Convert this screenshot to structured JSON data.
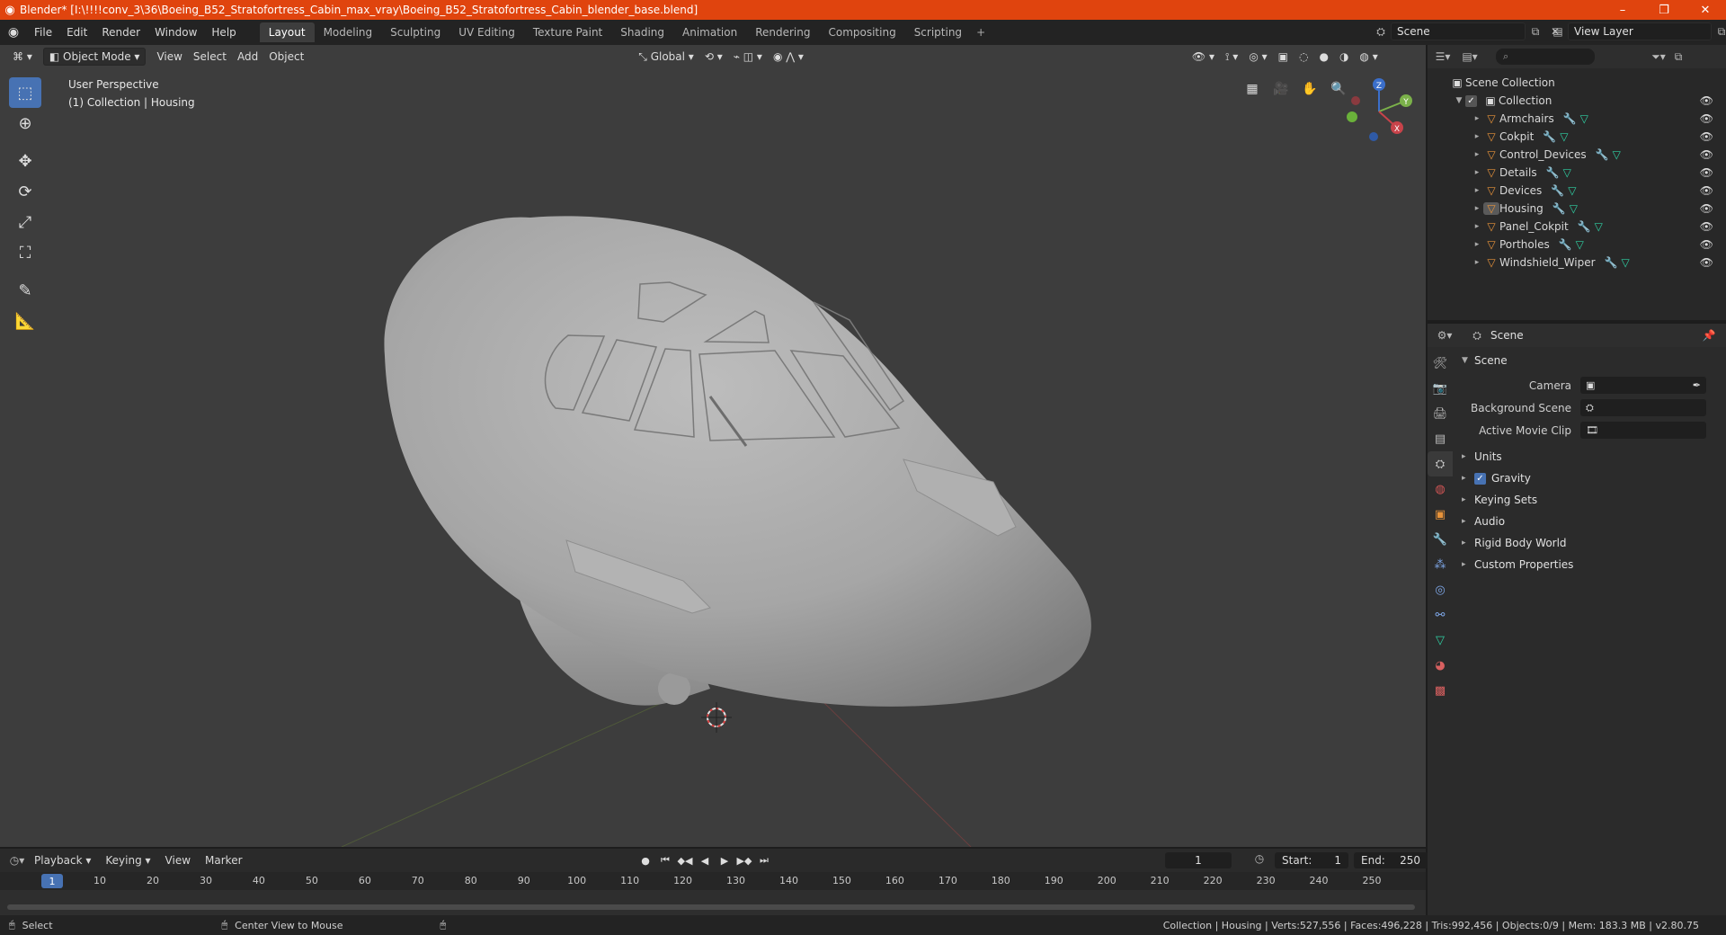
{
  "window": {
    "title": "Blender* [I:\\!!!!conv_3\\36\\Boeing_B52_Stratofortress_Cabin_max_vray\\Boeing_B52_Stratofortress_Cabin_blender_base.blend]"
  },
  "menus": [
    "File",
    "Edit",
    "Render",
    "Window",
    "Help"
  ],
  "workspaces": [
    "Layout",
    "Modeling",
    "Sculpting",
    "UV Editing",
    "Texture Paint",
    "Shading",
    "Animation",
    "Rendering",
    "Compositing",
    "Scripting"
  ],
  "active_workspace": "Layout",
  "scene_name": "Scene",
  "view_layer": "View Layer",
  "viewport": {
    "mode": "Object Mode",
    "menus": [
      "View",
      "Select",
      "Add",
      "Object"
    ],
    "orientation": "Global",
    "perspective": "User Perspective",
    "context": "(1) Collection | Housing",
    "gizmo": {
      "x": "X",
      "y": "Y",
      "z": "Z"
    }
  },
  "outliner": {
    "root": "Scene Collection",
    "collection": "Collection",
    "items": [
      "Armchairs",
      "Cokpit",
      "Control_Devices",
      "Details",
      "Devices",
      "Housing",
      "Panel_Cokpit",
      "Portholes",
      "Windshield_Wiper"
    ]
  },
  "properties": {
    "header": "Scene",
    "panel": "Scene",
    "fields": [
      {
        "label": "Camera",
        "value": ""
      },
      {
        "label": "Background Scene",
        "value": ""
      },
      {
        "label": "Active Movie Clip",
        "value": ""
      }
    ],
    "sections": [
      "Units",
      "Gravity",
      "Keying Sets",
      "Audio",
      "Rigid Body World",
      "Custom Properties"
    ],
    "gravity_checked": true
  },
  "timeline": {
    "menus": [
      "Playback",
      "Keying",
      "View",
      "Marker"
    ],
    "current_frame": "1",
    "start_label": "Start:",
    "start": "1",
    "end_label": "End:",
    "end": "250",
    "ticks": [
      "1",
      "10",
      "20",
      "30",
      "40",
      "50",
      "60",
      "70",
      "80",
      "90",
      "100",
      "110",
      "120",
      "130",
      "140",
      "150",
      "160",
      "170",
      "180",
      "190",
      "200",
      "210",
      "220",
      "230",
      "240",
      "250"
    ]
  },
  "status": {
    "left_action": "Select",
    "middle_action": "Center View to Mouse",
    "stats": "Collection | Housing | Verts:527,556 | Faces:496,228 | Tris:992,456 | Objects:0/9 | Mem: 183.3 MB | v2.80.75"
  },
  "colors": {
    "titlebar": "#e0440e",
    "accent": "#4772b3",
    "object_icon": "#e8933a",
    "mesh_icon": "#2fd1a4",
    "viewport_bg": "#3d3d3d"
  }
}
